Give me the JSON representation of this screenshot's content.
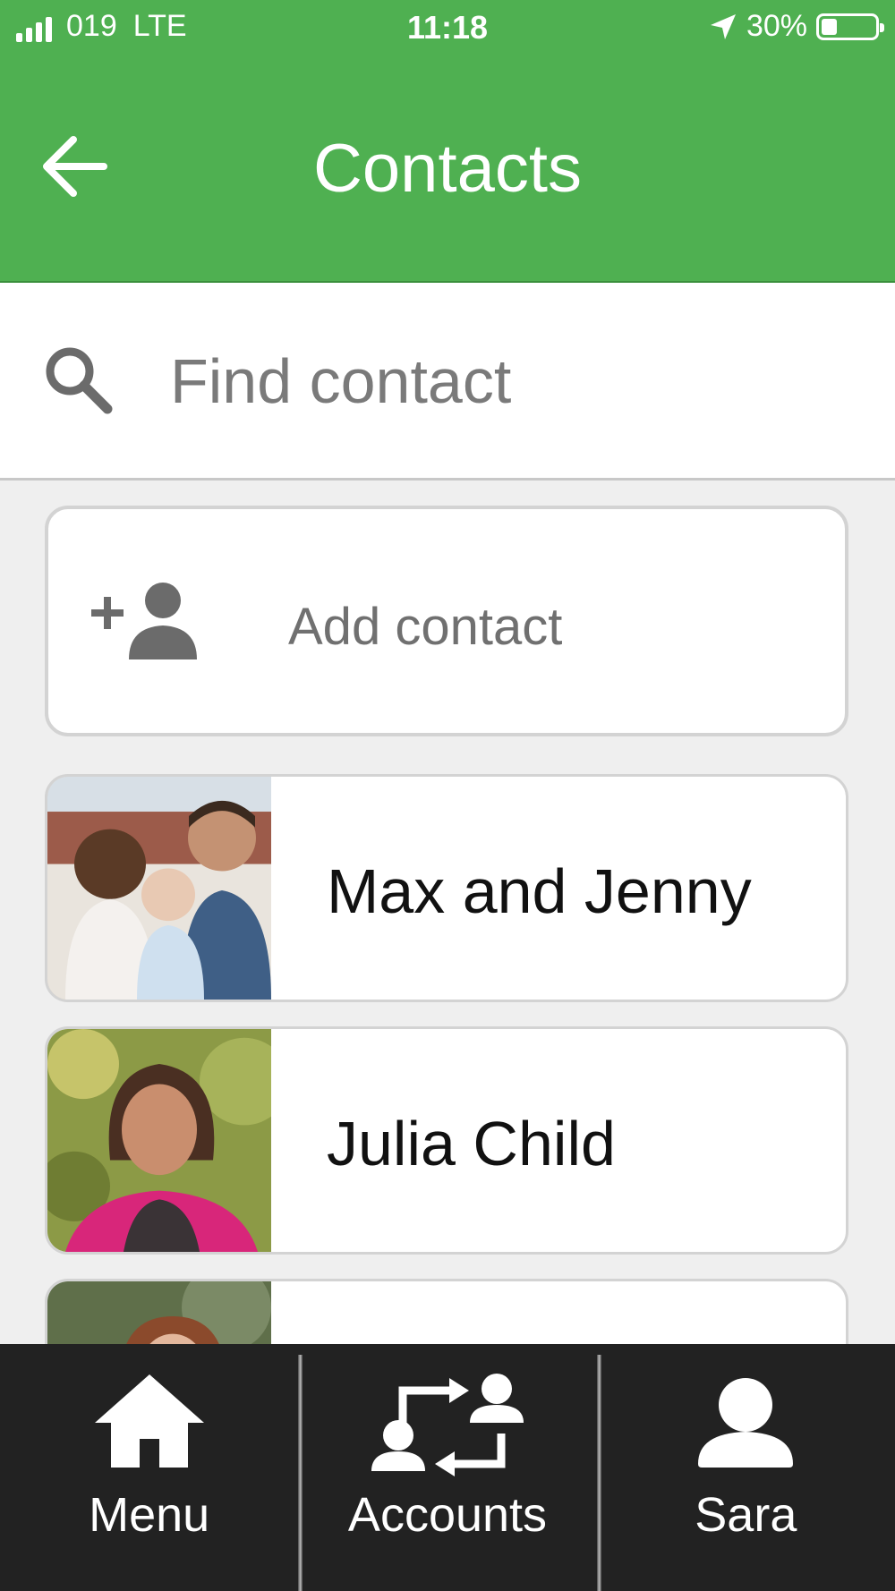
{
  "status_bar": {
    "carrier": "019",
    "network": "LTE",
    "time": "11:18",
    "battery": "30%",
    "battery_level": 0.3
  },
  "header": {
    "title": "Contacts",
    "back_icon": "arrow-left-icon",
    "color": "#4fb051"
  },
  "search": {
    "placeholder": "Find contact",
    "icon": "search-icon"
  },
  "add_contact": {
    "label": "Add contact",
    "icon": "add-person-icon"
  },
  "contacts": [
    {
      "name": "Max and Jenny"
    },
    {
      "name": "Julia Child"
    },
    {
      "name": ""
    }
  ],
  "bottom_nav": [
    {
      "label": "Menu",
      "icon": "home-icon"
    },
    {
      "label": "Accounts",
      "icon": "transfer-accounts-icon"
    },
    {
      "label": "Sara",
      "icon": "user-icon"
    }
  ]
}
